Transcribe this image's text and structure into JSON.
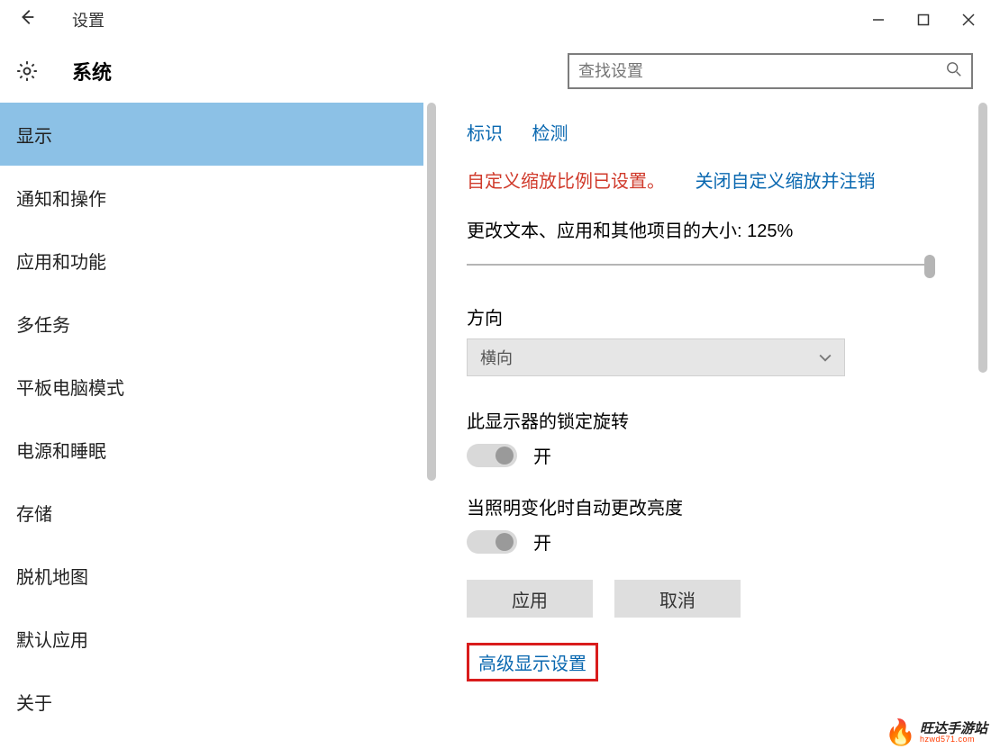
{
  "window": {
    "title": "设置"
  },
  "header": {
    "heading": "系统"
  },
  "search": {
    "placeholder": "查找设置"
  },
  "sidebar": {
    "items": [
      {
        "label": "显示",
        "active": true
      },
      {
        "label": "通知和操作"
      },
      {
        "label": "应用和功能"
      },
      {
        "label": "多任务"
      },
      {
        "label": "平板电脑模式"
      },
      {
        "label": "电源和睡眠"
      },
      {
        "label": "存储"
      },
      {
        "label": "脱机地图"
      },
      {
        "label": "默认应用"
      },
      {
        "label": "关于"
      }
    ]
  },
  "display": {
    "links": {
      "identify": "标识",
      "detect": "检测"
    },
    "status_red": "自定义缩放比例已设置。",
    "status_blue_link": "关闭自定义缩放并注销",
    "scale_label": "更改文本、应用和其他项目的大小: 125%",
    "orientation_label": "方向",
    "orientation_value": "横向",
    "lock_rotation_label": "此显示器的锁定旋转",
    "lock_rotation_value": "开",
    "auto_brightness_label": "当照明变化时自动更改亮度",
    "auto_brightness_value": "开",
    "apply_btn": "应用",
    "cancel_btn": "取消",
    "advanced_link": "高级显示设置"
  },
  "watermark": {
    "line1": "旺达手游站",
    "line2": "hzwd571.com"
  }
}
